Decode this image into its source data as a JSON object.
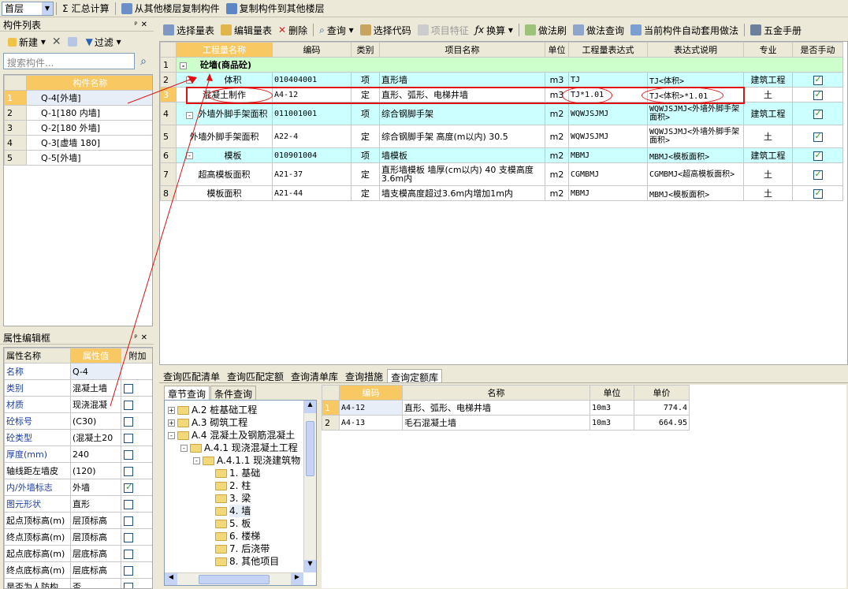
{
  "toolbar": {
    "floor": "首层",
    "sum": "汇总计算",
    "copy_from": "从其他楼层复制构件",
    "copy_to": "复制构件到其他楼层"
  },
  "component_list": {
    "title": "构件列表",
    "new": "新建",
    "filter": "过滤",
    "search_placeholder": "搜索构件...",
    "header": "构件名称",
    "items": [
      {
        "n": "1",
        "name": "Q-4[外墙]"
      },
      {
        "n": "2",
        "name": "Q-1[180 内墙]"
      },
      {
        "n": "3",
        "name": "Q-2[180 外墙]"
      },
      {
        "n": "4",
        "name": "Q-3[虚墙 180]"
      },
      {
        "n": "5",
        "name": "Q-5[外墙]"
      }
    ]
  },
  "props": {
    "title": "属性编辑框",
    "h_name": "属性名称",
    "h_value": "属性值",
    "h_add": "附加",
    "rows": [
      {
        "name": "名称",
        "value": "Q-4",
        "blue": true,
        "cb": false,
        "hascb": false
      },
      {
        "name": "类别",
        "value": "混凝土墙",
        "blue": true,
        "cb": false,
        "hascb": true
      },
      {
        "name": "材质",
        "value": "现浇混凝",
        "blue": true,
        "cb": false,
        "hascb": true
      },
      {
        "name": "砼标号",
        "value": "(C30)",
        "blue": true,
        "cb": false,
        "hascb": true
      },
      {
        "name": "砼类型",
        "value": "(混凝土20",
        "blue": true,
        "cb": false,
        "hascb": true
      },
      {
        "name": "厚度(mm)",
        "value": "240",
        "blue": true,
        "cb": false,
        "hascb": true
      },
      {
        "name": "轴线距左墙皮",
        "value": "(120)",
        "blue": false,
        "cb": false,
        "hascb": true
      },
      {
        "name": "内/外墙标志",
        "value": "外墙",
        "blue": true,
        "cb": true,
        "hascb": true
      },
      {
        "name": "图元形状",
        "value": "直形",
        "blue": true,
        "cb": false,
        "hascb": true
      },
      {
        "name": "起点顶标高(m)",
        "value": "层顶标高",
        "blue": false,
        "cb": false,
        "hascb": true
      },
      {
        "name": "终点顶标高(m)",
        "value": "层顶标高",
        "blue": false,
        "cb": false,
        "hascb": true
      },
      {
        "name": "起点底标高(m)",
        "value": "层底标高",
        "blue": false,
        "cb": false,
        "hascb": true
      },
      {
        "name": "终点底标高(m)",
        "value": "层底标高",
        "blue": false,
        "cb": false,
        "hascb": true
      },
      {
        "name": "是否为人防构",
        "value": "否",
        "blue": false,
        "cb": false,
        "hascb": true
      }
    ]
  },
  "main_toolbar": {
    "b1": "选择量表",
    "b2": "编辑量表",
    "b3": "删除",
    "b4": "查询",
    "b5": "选择代码",
    "b6": "项目特征",
    "b7": "换算",
    "b8": "做法刷",
    "b9": "做法查询",
    "b10": "当前构件自动套用做法",
    "b11": "五金手册"
  },
  "main_grid": {
    "headers": [
      "工程量名称",
      "编码",
      "类别",
      "项目名称",
      "单位",
      "工程量表达式",
      "表达式说明",
      "专业",
      "是否手动"
    ],
    "group": {
      "n": "1",
      "name": "砼墙(商品砼)"
    },
    "rows": [
      {
        "n": "2",
        "name": "体积",
        "code": "010404001",
        "type": "项",
        "item": "直形墙",
        "unit": "m3",
        "expr": "TJ",
        "desc": "TJ<体积>",
        "spec": "建筑工程",
        "cb": true,
        "cyan": true,
        "lvl": 1
      },
      {
        "n": "3",
        "name": "混凝土制作",
        "code": "A4-12",
        "type": "定",
        "item": "直形、弧形、电梯井墙",
        "unit": "m3",
        "expr": "TJ*1.01",
        "desc": "TJ<体积>*1.01",
        "spec": "土",
        "cb": true,
        "cyan": false,
        "lvl": 2
      },
      {
        "n": "4",
        "name": "外墙外脚手架面积",
        "code": "011001001",
        "type": "项",
        "item": "综合钢脚手架",
        "unit": "m2",
        "expr": "WQWJSJMJ",
        "desc": "WQWJSJMJ<外墙外脚手架面积>",
        "spec": "建筑工程",
        "cb": true,
        "cyan": true,
        "lvl": 1
      },
      {
        "n": "5",
        "name": "外墙外脚手架面积",
        "code": "A22-4",
        "type": "定",
        "item": "综合钢脚手架 高度(m以内) 30.5",
        "unit": "m2",
        "expr": "WQWJSJMJ",
        "desc": "WQWJSJMJ<外墙外脚手架面积>",
        "spec": "土",
        "cb": true,
        "cyan": false,
        "lvl": 2
      },
      {
        "n": "6",
        "name": "模板",
        "code": "010901004",
        "type": "项",
        "item": "墙模板",
        "unit": "m2",
        "expr": "MBMJ",
        "desc": "MBMJ<模板面积>",
        "spec": "建筑工程",
        "cb": true,
        "cyan": true,
        "lvl": 1
      },
      {
        "n": "7",
        "name": "超高模板面积",
        "code": "A21-37",
        "type": "定",
        "item": "直形墙模板 墙厚(cm以内) 40 支模高度3.6m内",
        "unit": "m2",
        "expr": "CGMBMJ",
        "desc": "CGMBMJ<超高模板面积>",
        "spec": "土",
        "cb": true,
        "cyan": false,
        "lvl": 2
      },
      {
        "n": "8",
        "name": "模板面积",
        "code": "A21-44",
        "type": "定",
        "item": "墙支模高度超过3.6m内增加1m内",
        "unit": "m2",
        "expr": "MBMJ",
        "desc": "MBMJ<模板面积>",
        "spec": "土",
        "cb": true,
        "cyan": false,
        "lvl": 2
      }
    ]
  },
  "bottom_tabs": [
    "查询匹配清单",
    "查询匹配定额",
    "查询清单库",
    "查询措施",
    "查询定额库"
  ],
  "sub_tabs": [
    "章节查询",
    "条件查询"
  ],
  "tree": [
    {
      "t": "A.2 桩基础工程",
      "lvl": 0,
      "pm": "+"
    },
    {
      "t": "A.3 砌筑工程",
      "lvl": 0,
      "pm": "+"
    },
    {
      "t": "A.4 混凝土及钢筋混凝土",
      "lvl": 0,
      "pm": "-"
    },
    {
      "t": "A.4.1 现浇混凝土工程",
      "lvl": 1,
      "pm": "-"
    },
    {
      "t": "A.4.1.1 现浇建筑物",
      "lvl": 2,
      "pm": "-"
    },
    {
      "t": "1. 基础",
      "lvl": 3,
      "pm": ""
    },
    {
      "t": "2. 柱",
      "lvl": 3,
      "pm": ""
    },
    {
      "t": "3. 梁",
      "lvl": 3,
      "pm": ""
    },
    {
      "t": "4. 墙",
      "lvl": 3,
      "pm": ""
    },
    {
      "t": "5. 板",
      "lvl": 3,
      "pm": ""
    },
    {
      "t": "6. 楼梯",
      "lvl": 3,
      "pm": ""
    },
    {
      "t": "7. 后浇带",
      "lvl": 3,
      "pm": ""
    },
    {
      "t": "8. 其他项目",
      "lvl": 3,
      "pm": ""
    }
  ],
  "quota": {
    "headers": [
      "编码",
      "名称",
      "单位",
      "单价"
    ],
    "rows": [
      {
        "n": "1",
        "code": "A4-12",
        "name": "直形、弧形、电梯井墙",
        "unit": "10m3",
        "price": "774.4"
      },
      {
        "n": "2",
        "code": "A4-13",
        "name": "毛石混凝土墙",
        "unit": "10m3",
        "price": "664.95"
      }
    ]
  }
}
